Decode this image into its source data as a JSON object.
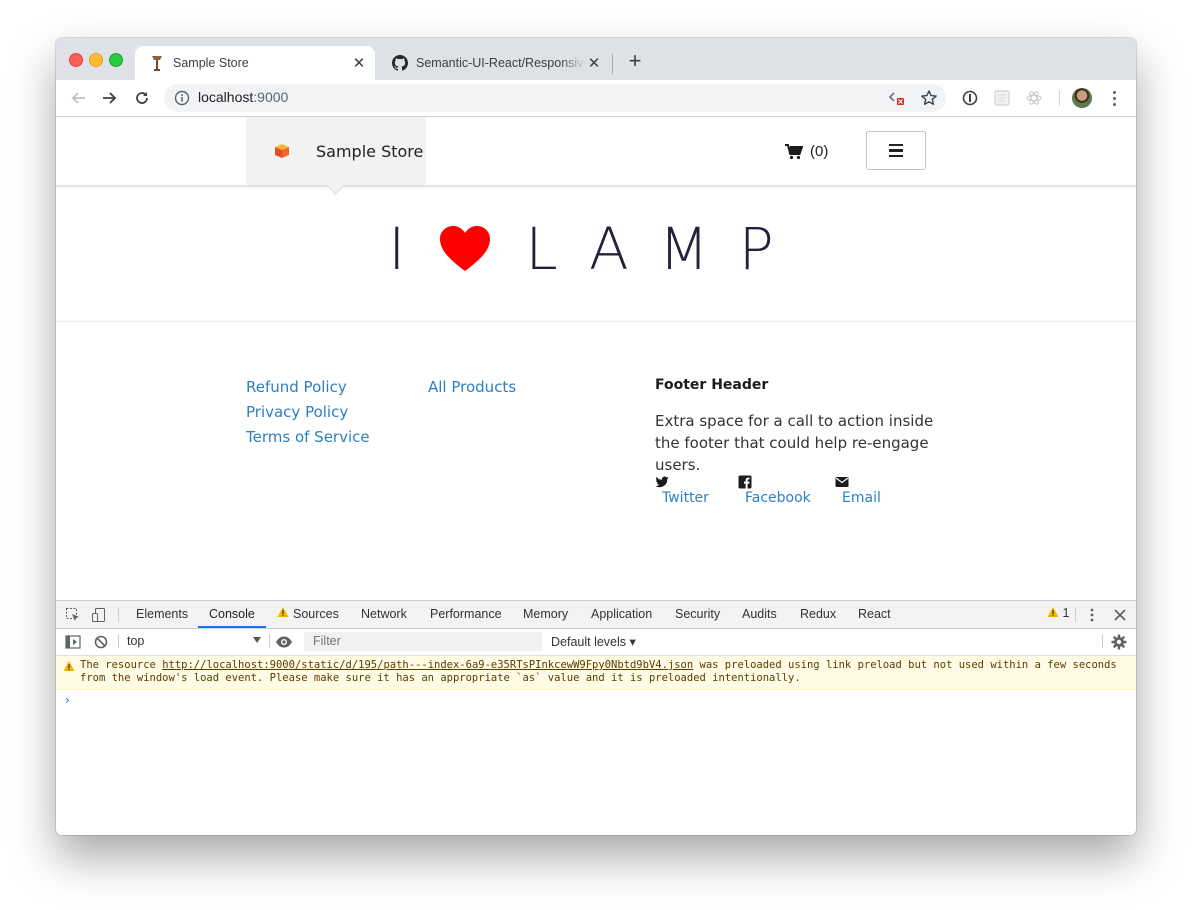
{
  "browser": {
    "tabs": [
      {
        "title": "Sample Store",
        "close": "✕"
      },
      {
        "title": "Semantic-UI-React/Responsive",
        "close": "✕"
      }
    ],
    "new_tab": "+",
    "url_host": "localhost",
    "url_port": ":9000"
  },
  "site": {
    "brand": "Sample Store",
    "cart_count": "(0)",
    "hero": {
      "left": "I",
      "right": "LAMP"
    }
  },
  "footer": {
    "links_col1": [
      "Refund Policy",
      "Privacy Policy",
      "Terms of Service"
    ],
    "links_col2": [
      "All Products"
    ],
    "header": "Footer Header",
    "text": "Extra space for a call to action inside the footer that could help re-engage users.",
    "social": [
      {
        "label": "Twitter",
        "icon": "twitter-icon"
      },
      {
        "label": "Facebook",
        "icon": "facebook-icon"
      },
      {
        "label": "Email",
        "icon": "envelope-icon"
      }
    ]
  },
  "devtools": {
    "tabs": [
      "Elements",
      "Console",
      "Sources",
      "Network",
      "Performance",
      "Memory",
      "Application",
      "Security",
      "Audits",
      "Redux",
      "React"
    ],
    "active_tab": "Console",
    "warning_count": "1",
    "context": "top",
    "filter_placeholder": "Filter",
    "levels": "Default levels ▾",
    "warning": {
      "prefix": "The resource ",
      "url": "http://localhost:9000/static/d/195/path---index-6a9-e35RTsPInkcewW9Fpy0Nbtd9bV4.json",
      "suffix": " was preloaded using link preload but not used within a few seconds from the window's load event. Please make sure it has an appropriate `as` value and it is preloaded intentionally."
    },
    "prompt": "›"
  },
  "colors": {
    "link": "#2d7fc4",
    "heart": "#ff0000",
    "devtools_accent": "#1a73e8",
    "warning_bg": "#fffbe5"
  }
}
